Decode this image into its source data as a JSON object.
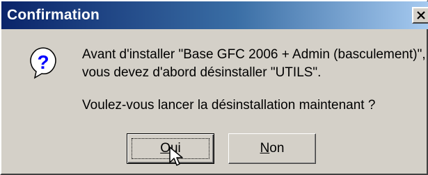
{
  "dialog": {
    "title": "Confirmation",
    "message_line1": "Avant d'installer \"Base GFC 2006 + Admin (basculement)\",",
    "message_line2": "vous devez d'abord désinstaller \"UTILS\".",
    "question": "Voulez-vous lancer la désinstallation maintenant ?",
    "icon": "question-icon",
    "close_icon": "close-icon"
  },
  "buttons": {
    "yes": {
      "mnemonic": "O",
      "rest": "ui"
    },
    "no": {
      "mnemonic": "N",
      "rest": "on"
    }
  },
  "colors": {
    "title_start": "#0a246a",
    "title_end": "#a6caf0",
    "face": "#d4d0c8",
    "icon_blue": "#0000ff"
  }
}
